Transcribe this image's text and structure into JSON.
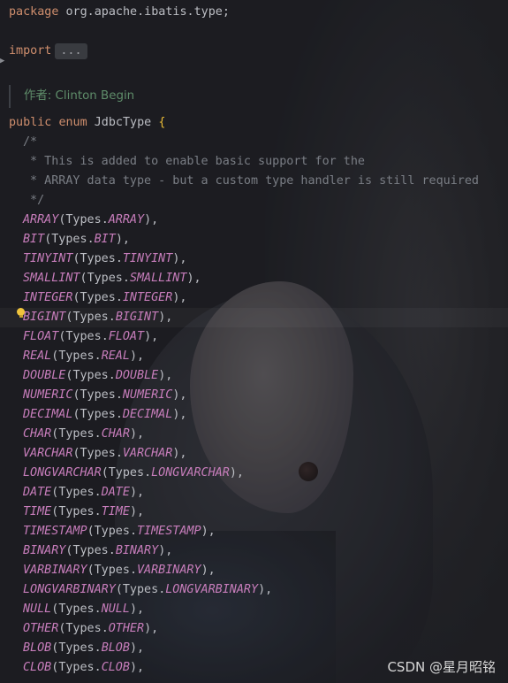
{
  "code": {
    "package_keyword": "package",
    "package_name": "org.apache.ibatis.type;",
    "import_keyword": "import",
    "import_fold": "...",
    "author_hint": "作者: Clinton Begin",
    "class_modifier": "public",
    "class_kind": "enum",
    "class_name": "JdbcType",
    "open_brace": "{",
    "comment_lines": [
      "/*",
      " * This is added to enable basic support for the",
      " * ARRAY data type - but a custom type handler is still required",
      " */"
    ],
    "constants": [
      {
        "name": "ARRAY",
        "arg": "ARRAY"
      },
      {
        "name": "BIT",
        "arg": "BIT"
      },
      {
        "name": "TINYINT",
        "arg": "TINYINT"
      },
      {
        "name": "SMALLINT",
        "arg": "SMALLINT"
      },
      {
        "name": "INTEGER",
        "arg": "INTEGER"
      },
      {
        "name": "BIGINT",
        "arg": "BIGINT"
      },
      {
        "name": "FLOAT",
        "arg": "FLOAT"
      },
      {
        "name": "REAL",
        "arg": "REAL"
      },
      {
        "name": "DOUBLE",
        "arg": "DOUBLE"
      },
      {
        "name": "NUMERIC",
        "arg": "NUMERIC"
      },
      {
        "name": "DECIMAL",
        "arg": "DECIMAL"
      },
      {
        "name": "CHAR",
        "arg": "CHAR"
      },
      {
        "name": "VARCHAR",
        "arg": "VARCHAR"
      },
      {
        "name": "LONGVARCHAR",
        "arg": "LONGVARCHAR"
      },
      {
        "name": "DATE",
        "arg": "DATE"
      },
      {
        "name": "TIME",
        "arg": "TIME"
      },
      {
        "name": "TIMESTAMP",
        "arg": "TIMESTAMP"
      },
      {
        "name": "BINARY",
        "arg": "BINARY"
      },
      {
        "name": "VARBINARY",
        "arg": "VARBINARY"
      },
      {
        "name": "LONGVARBINARY",
        "arg": "LONGVARBINARY"
      },
      {
        "name": "NULL",
        "arg": "NULL"
      },
      {
        "name": "OTHER",
        "arg": "OTHER"
      },
      {
        "name": "BLOB",
        "arg": "BLOB"
      },
      {
        "name": "CLOB",
        "arg": "CLOB"
      }
    ],
    "types_class": "Types"
  },
  "icons": {
    "gutter_fold": "chevron-right-icon",
    "intention": "lightbulb-icon"
  },
  "watermark": "CSDN @星月昭铭",
  "colors": {
    "keyword": "#cf8e6d",
    "constant": "#c77dbb",
    "comment": "#7a7e85",
    "text": "#bcbec4",
    "author": "#5f8d6a",
    "bulb": "#f0c43c"
  }
}
